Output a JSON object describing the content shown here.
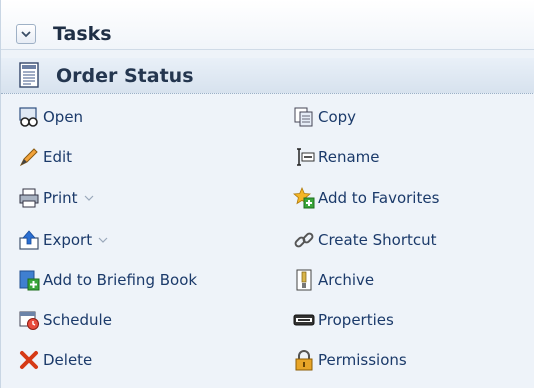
{
  "panel": {
    "title": "Tasks",
    "section_title": "Order Status"
  },
  "actions": {
    "open": "Open",
    "edit": "Edit",
    "print": "Print",
    "export": "Export",
    "add_to_briefing_book": "Add to Briefing Book",
    "schedule": "Schedule",
    "delete": "Delete",
    "copy": "Copy",
    "rename": "Rename",
    "add_to_favorites": "Add to Favorites",
    "create_shortcut": "Create Shortcut",
    "archive": "Archive",
    "properties": "Properties",
    "permissions": "Permissions"
  },
  "colors": {
    "link_text": "#1b3a6a",
    "panel_bg": "#eef3f9",
    "header_text": "#1f2f45"
  }
}
